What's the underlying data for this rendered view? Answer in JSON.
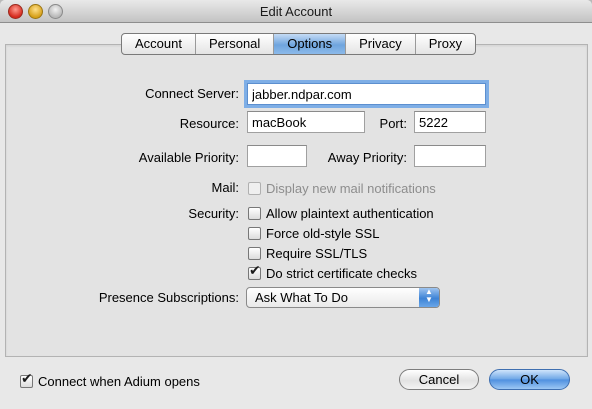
{
  "window": {
    "title": "Edit Account"
  },
  "tabs": [
    {
      "label": "Account",
      "active": false
    },
    {
      "label": "Personal",
      "active": false
    },
    {
      "label": "Options",
      "active": true
    },
    {
      "label": "Privacy",
      "active": false
    },
    {
      "label": "Proxy",
      "active": false
    }
  ],
  "form": {
    "connect_server": {
      "label": "Connect Server:",
      "value": "jabber.ndpar.com"
    },
    "resource": {
      "label": "Resource:",
      "value": "macBook"
    },
    "port": {
      "label": "Port:",
      "value": "5222"
    },
    "available_priority": {
      "label": "Available Priority:",
      "value": ""
    },
    "away_priority": {
      "label": "Away Priority:",
      "value": ""
    },
    "mail": {
      "label": "Mail:",
      "option": "Display new mail notifications",
      "checked": false,
      "enabled": false
    },
    "security": {
      "label": "Security:",
      "options": [
        {
          "label": "Allow plaintext authentication",
          "checked": false
        },
        {
          "label": "Force old-style SSL",
          "checked": false
        },
        {
          "label": "Require SSL/TLS",
          "checked": false
        },
        {
          "label": "Do strict certificate checks",
          "checked": true
        }
      ]
    },
    "presence": {
      "label": "Presence Subscriptions:",
      "selected": "Ask What To Do"
    }
  },
  "footer": {
    "connect_on_open": {
      "label": "Connect when Adium opens",
      "checked": true
    },
    "cancel_label": "Cancel",
    "ok_label": "OK"
  },
  "colors": {
    "accent": "#6fa5de",
    "focus_ring": "#7eaee6"
  }
}
